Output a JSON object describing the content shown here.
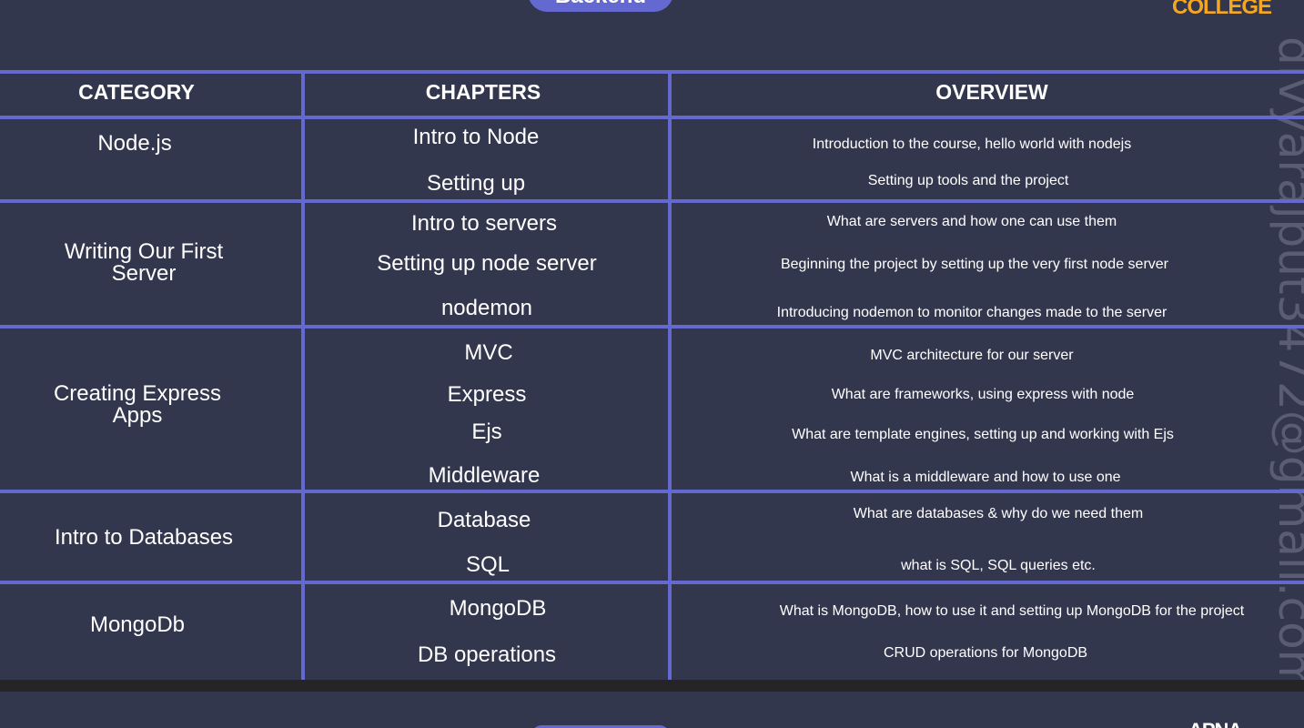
{
  "header": {
    "section_pill": "Backend",
    "logo_text": "COLLEGE"
  },
  "watermark": "divyarajput3472@gmail.com",
  "table": {
    "columns": [
      "CATEGORY",
      "CHAPTERS",
      "OVERVIEW"
    ],
    "categories": [
      "Node.js",
      "Writing Our First Server",
      "Creating Express Apps",
      "Intro to Databases",
      "MongoDb"
    ],
    "chapters": [
      "Intro to Node",
      "Setting up",
      "Intro to servers",
      "Setting up node server",
      "nodemon",
      "MVC",
      "Express",
      "Ejs",
      "Middleware",
      "Database",
      "SQL",
      "MongoDB",
      "DB operations"
    ],
    "overviews": [
      "Introduction to the course, hello world with nodejs",
      "Setting up tools and the project",
      "What are servers and how one can use them",
      "Beginning the project by setting up the very first node server",
      "Introducing nodemon to monitor changes made to the server",
      "MVC architecture for our server",
      "What are frameworks, using express with node",
      "What are template engines, setting up and working with Ejs",
      "What is a middleware and how to use one",
      "What are databases & why do we need them",
      "what is SQL, SQL queries etc.",
      "What is MongoDB, how to use it and setting up MongoDB for the project",
      "CRUD operations for MongoDB"
    ]
  },
  "next_page": {
    "logo_text": "APNA"
  },
  "colors": {
    "background": "#33374e",
    "grid_lines": "#6469cf",
    "pill": "#6369d1",
    "logo": "#f5a623",
    "text": "#ffffff"
  }
}
